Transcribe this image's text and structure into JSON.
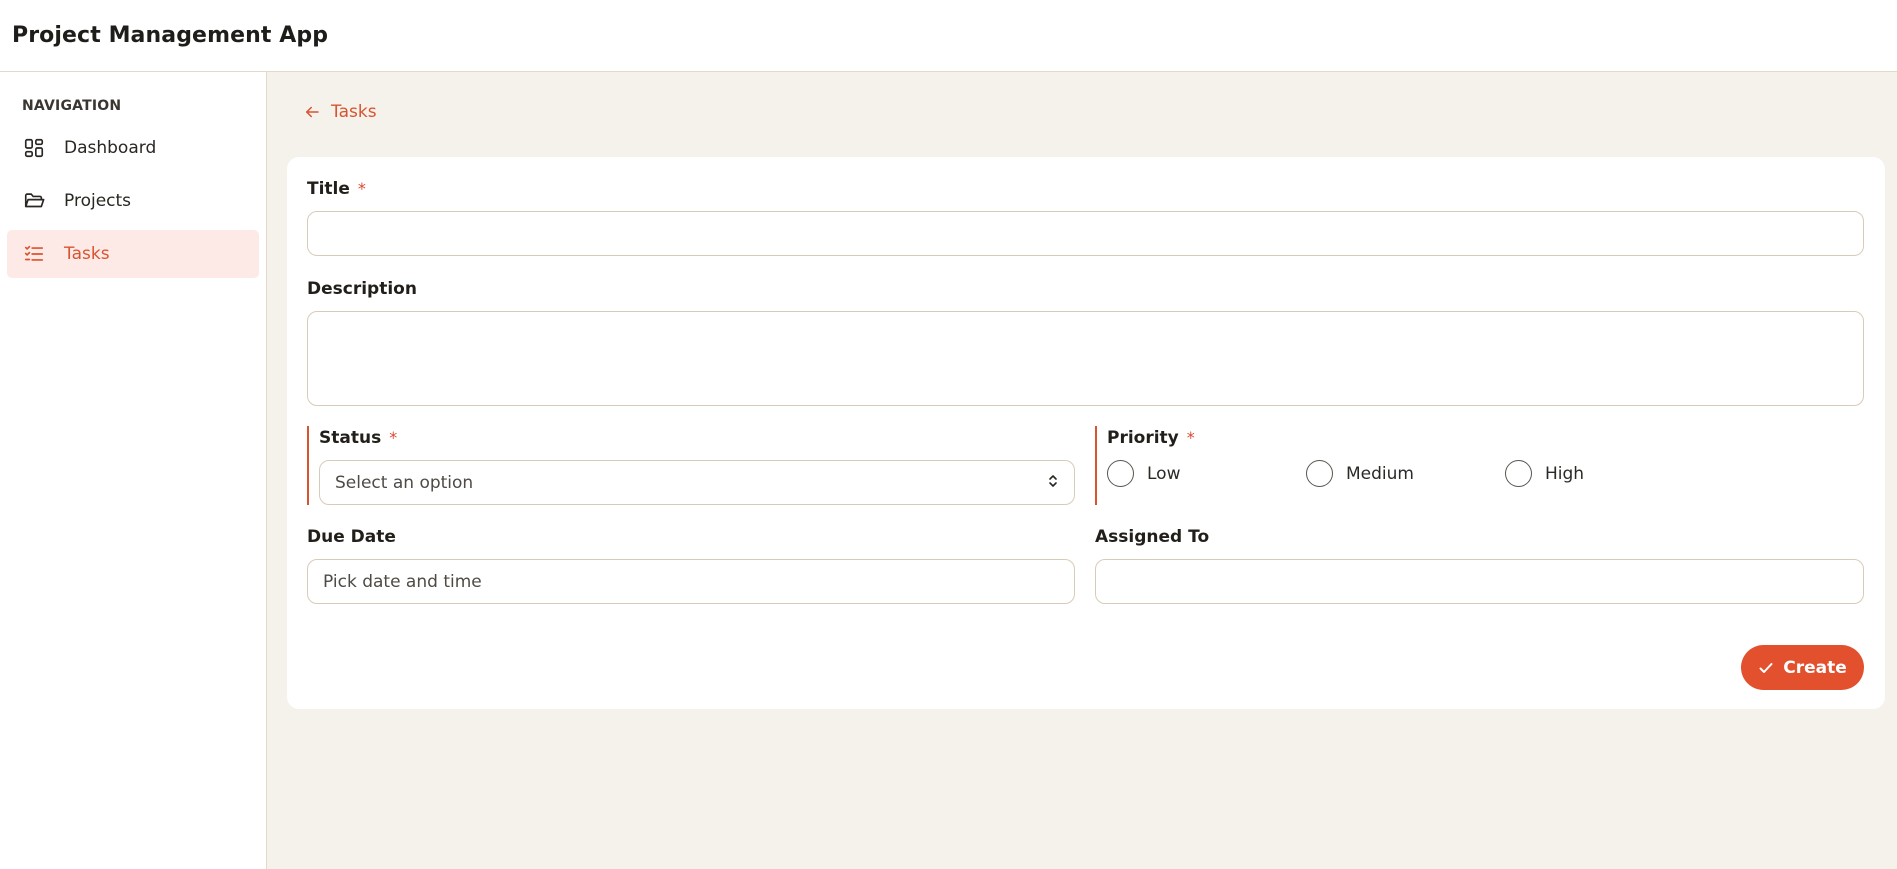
{
  "app": {
    "title": "Project Management App"
  },
  "sidebar": {
    "heading": "NAVIGATION",
    "items": [
      {
        "label": "Dashboard",
        "icon": "dashboard-icon",
        "active": false
      },
      {
        "label": "Projects",
        "icon": "folder-icon",
        "active": false
      },
      {
        "label": "Tasks",
        "icon": "task-list-icon",
        "active": true
      }
    ]
  },
  "breadcrumb": {
    "back_label": "Tasks",
    "icon": "arrow-left-icon"
  },
  "form": {
    "title": {
      "label": "Title",
      "required_mark": "*",
      "value": ""
    },
    "description": {
      "label": "Description",
      "value": ""
    },
    "status": {
      "label": "Status",
      "required_mark": "*",
      "placeholder": "Select an option",
      "icon": "chevron-up-down-icon"
    },
    "priority": {
      "label": "Priority",
      "required_mark": "*",
      "options": [
        "Low",
        "Medium",
        "High"
      ]
    },
    "due_date": {
      "label": "Due Date",
      "placeholder": "Pick date and time"
    },
    "assigned_to": {
      "label": "Assigned To",
      "value": ""
    },
    "submit": {
      "label": "Create",
      "icon": "check-icon"
    }
  },
  "colors": {
    "accent": "#e2502e",
    "active_nav_bg": "#fdeae6",
    "main_bg": "#f5f2ec",
    "border": "#d8ccb9"
  }
}
